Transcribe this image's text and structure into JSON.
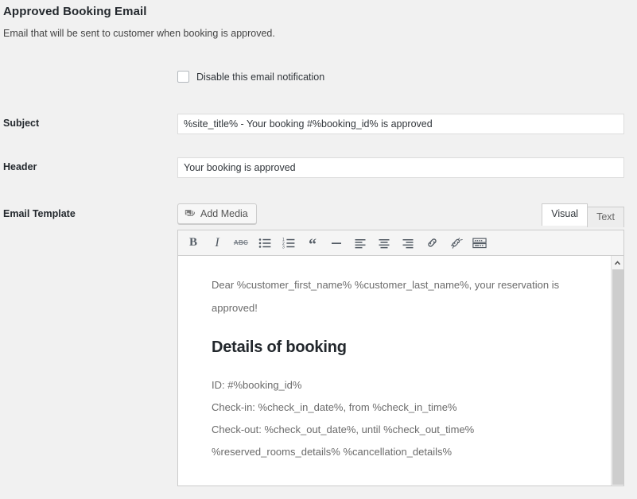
{
  "page": {
    "title": "Approved Booking Email",
    "description": "Email that will be sent to customer when booking is approved."
  },
  "disable_notification": {
    "label": "Disable this email notification",
    "checked": false
  },
  "fields": {
    "subject": {
      "label": "Subject",
      "value": "%site_title% - Your booking #%booking_id% is approved"
    },
    "header": {
      "label": "Header",
      "value": "Your booking is approved"
    },
    "email_template": {
      "label": "Email Template"
    }
  },
  "editor": {
    "add_media_label": "Add Media",
    "tabs": [
      {
        "label": "Visual",
        "active": true
      },
      {
        "label": "Text",
        "active": false
      }
    ],
    "toolbar": [
      {
        "name": "bold",
        "glyph": "B"
      },
      {
        "name": "italic",
        "glyph": "I"
      },
      {
        "name": "strikethrough",
        "glyph": "ABC"
      },
      {
        "name": "bulleted-list",
        "glyph": ""
      },
      {
        "name": "numbered-list",
        "glyph": ""
      },
      {
        "name": "blockquote",
        "glyph": "“"
      },
      {
        "name": "horizontal-rule",
        "glyph": ""
      },
      {
        "name": "align-left",
        "glyph": ""
      },
      {
        "name": "align-center",
        "glyph": ""
      },
      {
        "name": "align-right",
        "glyph": ""
      },
      {
        "name": "insert-link",
        "glyph": ""
      },
      {
        "name": "remove-link",
        "glyph": ""
      },
      {
        "name": "toolbar-toggle",
        "glyph": ""
      }
    ],
    "content": {
      "intro": "Dear %customer_first_name% %customer_last_name%, your reservation is approved!",
      "heading": "Details of booking",
      "lines": [
        "ID: #%booking_id%",
        "Check-in: %check_in_date%, from %check_in_time%",
        "Check-out: %check_out_date%, until %check_out_time%",
        "%reserved_rooms_details% %cancellation_details%"
      ]
    }
  },
  "colors": {
    "page_background": "#f1f1f1",
    "text": "#32373c",
    "heading": "#23282d",
    "border": "#cccccc",
    "input_border": "#dddddd",
    "editor_text": "#6b6b6b",
    "scrollbar_thumb": "#cdcdcd"
  }
}
